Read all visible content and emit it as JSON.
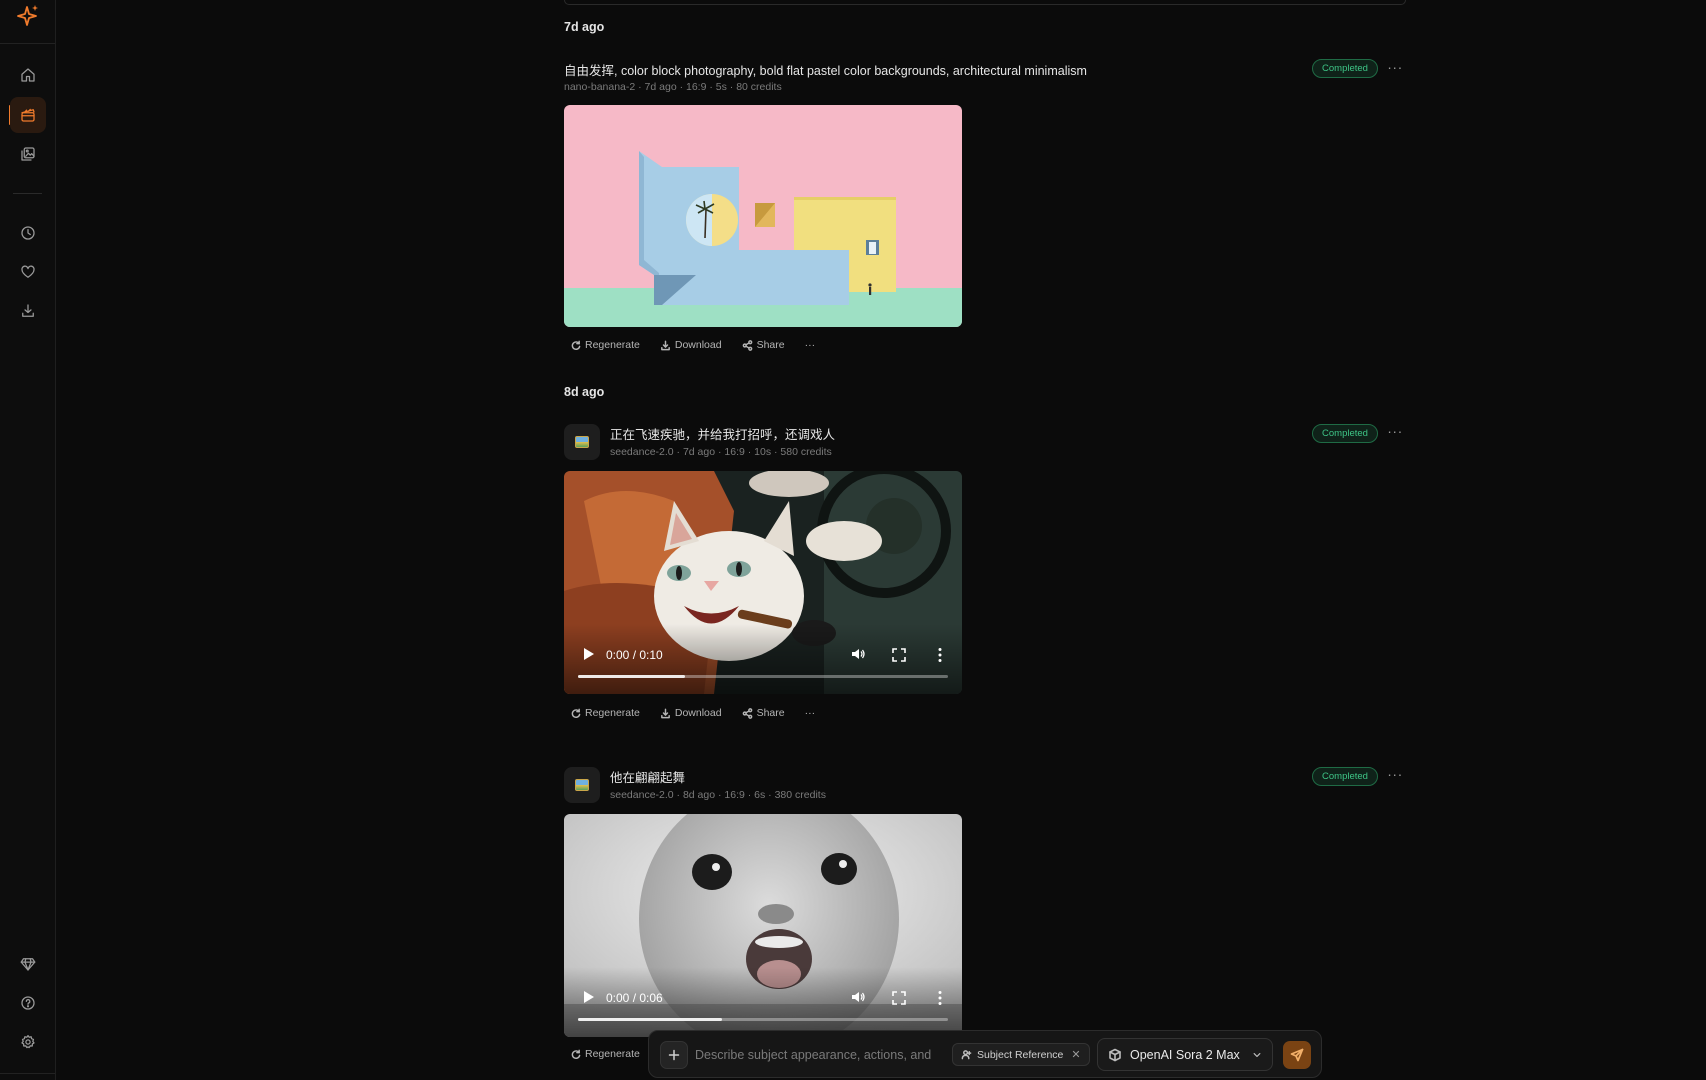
{
  "feed": {
    "groups": [
      {
        "label": "7d ago"
      },
      {
        "label": "8d ago"
      }
    ],
    "items": [
      {
        "title": "自由发挥, color block photography, bold flat pastel color backgrounds, architectural minimalism",
        "meta": "nano-banana-2 · 7d ago · 16:9 · 5s · 80 credits",
        "status": "Completed",
        "media_type": "image"
      },
      {
        "title": "正在飞速疾驰，并给我打招呼，还调戏人",
        "meta": "seedance-2.0 · 7d ago · 16:9 · 10s · 580 credits",
        "status": "Completed",
        "media_type": "video",
        "video_time": "0:00 / 0:10",
        "buffered_fraction": 0.29
      },
      {
        "title": "他在翩翩起舞",
        "meta": "seedance-2.0 · 8d ago · 16:9 · 6s · 380 credits",
        "status": "Completed",
        "media_type": "video",
        "video_time": "0:00 / 0:06",
        "buffered_fraction": 0.39
      }
    ],
    "actions": {
      "regenerate": "Regenerate",
      "download": "Download",
      "share": "Share",
      "more": "···"
    }
  },
  "prompt_bar": {
    "placeholder": "Describe subject appearance, actions, and",
    "chip_label": "Subject Reference",
    "model_name": "OpenAI Sora 2 Max"
  },
  "sidebar": {
    "items": [
      {
        "icon": "home-icon"
      },
      {
        "icon": "clapperboard-icon",
        "active": true
      },
      {
        "icon": "gallery-icon"
      },
      {
        "icon": "clock-icon"
      },
      {
        "icon": "heart-icon"
      },
      {
        "icon": "download-icon"
      },
      {
        "icon": "diamond-icon"
      },
      {
        "icon": "help-icon"
      },
      {
        "icon": "settings-icon"
      }
    ]
  },
  "colors": {
    "accent": "#f07b2c",
    "status_green": "#3ec486",
    "background": "#0b0b0b"
  }
}
